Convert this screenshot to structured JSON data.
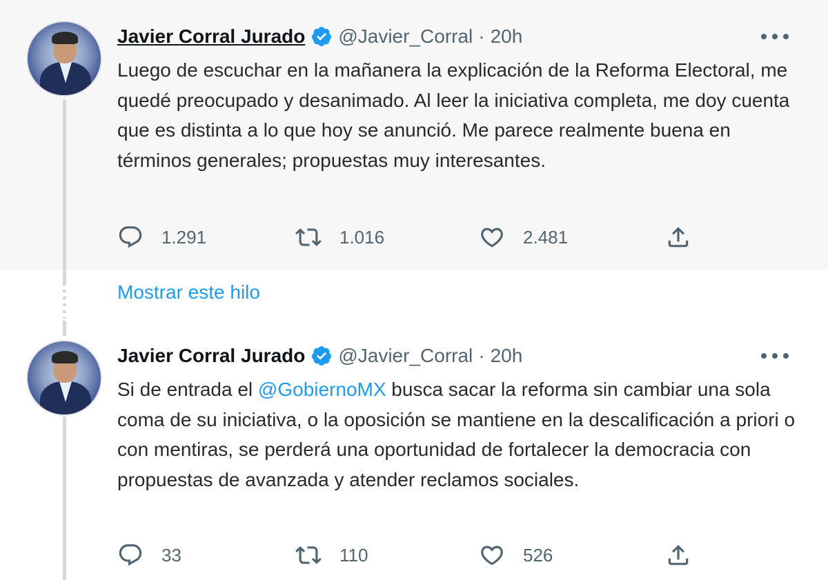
{
  "tweets": [
    {
      "author_name": "Javier Corral Jurado",
      "handle": "@Javier_Corral",
      "separator": "·",
      "time": "20h",
      "text": "Luego de escuchar en la mañanera la explicación de la Reforma Electoral, me quedé preocupado y desanimado. Al leer la iniciativa completa, me doy cuenta que es distinta a lo que hoy se anunció. Me parece realmente buena en términos generales; propuestas muy interesantes.",
      "replies": "1.291",
      "retweets": "1.016",
      "likes": "2.481"
    },
    {
      "author_name": "Javier Corral Jurado",
      "handle": "@Javier_Corral",
      "separator": "·",
      "time": "20h",
      "text_before": "Si de entrada el ",
      "mention": "@GobiernoMX",
      "text_after": " busca sacar la reforma sin cambiar una sola coma de su iniciativa, o la oposición se mantiene en la descalificación a priori o con mentiras, se perderá una oportunidad de fortalecer la democracia con propuestas de avanzada y atender reclamos sociales.",
      "replies": "33",
      "retweets": "110",
      "likes": "526"
    }
  ],
  "show_thread_label": "Mostrar este hilo",
  "icons": [
    "verified-badge-icon",
    "more-options-icon",
    "reply-icon",
    "retweet-icon",
    "like-icon",
    "share-icon"
  ],
  "colors": {
    "accent": "#1d9bf0",
    "secondary_text": "#536471",
    "highlight_bg": "#f7f7f7",
    "thread_line": "#cfd9de"
  }
}
